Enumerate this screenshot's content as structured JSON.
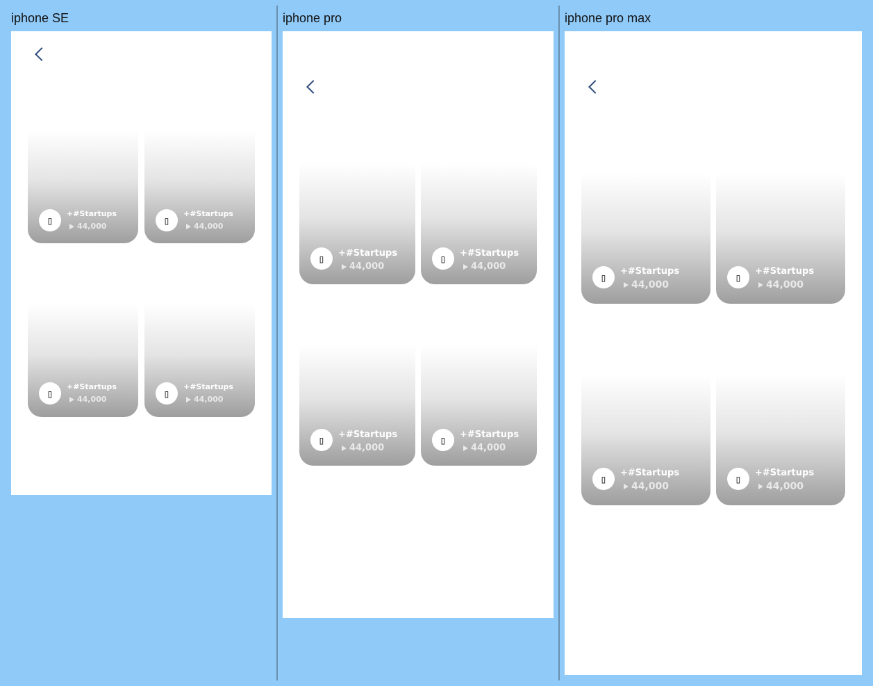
{
  "devices": [
    {
      "label": "iphone SE"
    },
    {
      "label": "iphone pro"
    },
    {
      "label": "iphone pro max"
    }
  ],
  "card": {
    "tag": "+#Startups",
    "views": "44,000",
    "avatar_glyph": "▯"
  },
  "icons": {
    "back": "chevron-left-icon",
    "play": "play-icon"
  },
  "colors": {
    "background": "#90caf9",
    "screen": "#ffffff",
    "back_icon": "#2c4a7a"
  }
}
